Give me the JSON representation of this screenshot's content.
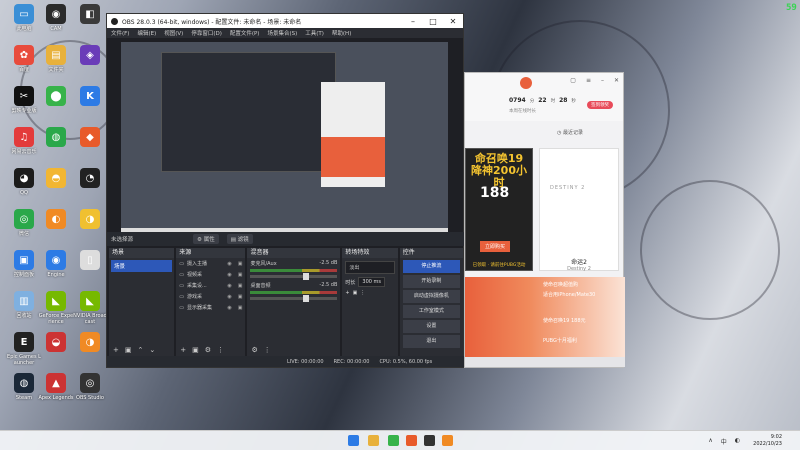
{
  "desktop": {
    "icons": [
      {
        "label": "此电脑",
        "color": "#3b8fd6",
        "glyph": "▭"
      },
      {
        "label": "CAM",
        "color": "#2b2b2b",
        "glyph": "◉"
      },
      {
        "label": "",
        "color": "#3a3a3a",
        "glyph": "◧"
      },
      {
        "label": "百度",
        "color": "#e84b3c",
        "glyph": "✿"
      },
      {
        "label": "文件夹",
        "color": "#e8b13c",
        "glyph": "▤"
      },
      {
        "label": "",
        "color": "#6a3cb8",
        "glyph": "◈"
      },
      {
        "label": "剪映专业版",
        "color": "#111",
        "glyph": "✂"
      },
      {
        "label": "",
        "color": "#37b34a",
        "glyph": "⬤"
      },
      {
        "label": "",
        "color": "#2d7be5",
        "glyph": "K"
      },
      {
        "label": "网易云音乐",
        "color": "#e33b3b",
        "glyph": "♫"
      },
      {
        "label": "",
        "color": "#2aa84a",
        "glyph": "◍"
      },
      {
        "label": "",
        "color": "#e85a2a",
        "glyph": "◆"
      },
      {
        "label": "QQ",
        "color": "#1c1c1c",
        "glyph": "◕"
      },
      {
        "label": "",
        "color": "#f2b632",
        "glyph": "◓"
      },
      {
        "label": "",
        "color": "#222",
        "glyph": "◔"
      },
      {
        "label": "微信",
        "color": "#2aa84a",
        "glyph": "◎"
      },
      {
        "label": "",
        "color": "#f08a24",
        "glyph": "◐"
      },
      {
        "label": "",
        "color": "#f0c030",
        "glyph": "◑"
      },
      {
        "label": "控制面板",
        "color": "#2d7be5",
        "glyph": "▣"
      },
      {
        "label": "Engine",
        "color": "#2d7be5",
        "glyph": "◉"
      },
      {
        "label": "",
        "color": "#ddd",
        "glyph": "▯"
      },
      {
        "label": "回收站",
        "color": "#7fb0e0",
        "glyph": "▥"
      },
      {
        "label": "GeForce Experience",
        "color": "#76b900",
        "glyph": "◣"
      },
      {
        "label": "NVIDIA Broadcast",
        "color": "#76b900",
        "glyph": "◣"
      },
      {
        "label": "Epic Games Launcher",
        "color": "#222",
        "glyph": "E"
      },
      {
        "label": "",
        "color": "#c33",
        "glyph": "◒"
      },
      {
        "label": "",
        "color": "#f08a24",
        "glyph": "◑"
      },
      {
        "label": "Steam",
        "color": "#1b2838",
        "glyph": "◍"
      },
      {
        "label": "Apex Legends",
        "color": "#c33",
        "glyph": "▲"
      },
      {
        "label": "OBS Studio",
        "color": "#333",
        "glyph": "◎"
      }
    ],
    "fps": "59"
  },
  "obs": {
    "title": "OBS 28.0.3 (64-bit, windows) - 配置文件: 未命名 - 场景: 未命名",
    "menu": [
      "文件(F)",
      "编辑(E)",
      "视图(V)",
      "停靠窗口(D)",
      "配置文件(P)",
      "场景集合(S)",
      "工具(T)",
      "帮助(H)"
    ],
    "source_bar": {
      "label": "未选择源",
      "properties": "属性",
      "filters": "滤镜"
    },
    "docks": {
      "scenes": {
        "title": "场景",
        "items": [
          "场景"
        ]
      },
      "sources": {
        "title": "来源",
        "items": [
          {
            "name": "摄入主播"
          },
          {
            "name": "视频采"
          },
          {
            "name": "采集设..."
          },
          {
            "name": "游戏采"
          },
          {
            "name": "显示器采集"
          }
        ]
      },
      "mixer": {
        "title": "混音器",
        "tracks": [
          {
            "name": "麦克风/Aux",
            "db": "-2.5 dB",
            "level": 0.6
          },
          {
            "name": "桌面音频",
            "db": "-2.5 dB",
            "level": 0.6
          }
        ]
      },
      "transitions": {
        "title": "转场特效",
        "type": "淡出",
        "duration_label": "时长",
        "duration": "300 ms"
      },
      "controls": {
        "title": "控件",
        "buttons": [
          "停止推流",
          "开始录制",
          "启动虚拟摄像机",
          "工作室模式",
          "设置",
          "退出"
        ]
      }
    },
    "status": {
      "live": "LIVE: 00:00:00",
      "rec": "REC: 00:00:00",
      "cpu": "CPU: 0.5%, 60.00 fps"
    }
  },
  "gamecenter": {
    "stats": [
      {
        "value": "0794",
        "unit": "分"
      },
      {
        "value": "22",
        "unit": "时"
      },
      {
        "value": "28",
        "unit": "秒"
      }
    ],
    "sub": "本周在线时长",
    "pill": "签到领奖",
    "recent": "最近记录",
    "card1": {
      "line1": "命召唤19",
      "line2": "降神200小时",
      "price": "188",
      "note": "已领取 · 请前往PUBG活动",
      "button": "立即购买"
    },
    "card2": {
      "logo": "DESTINY 2",
      "name": "命运2",
      "en": "Destiny 2"
    },
    "banner": [
      "使命召唤超值购",
      "适合用iPhone/Mate30",
      "使命召唤19 188元",
      "PUBG十月福利"
    ],
    "footer": [
      "",
      "",
      "",
      "",
      ""
    ]
  },
  "taskbar": {
    "tray": [
      "∧",
      "中",
      "◐"
    ],
    "time": "9:02",
    "date": "2022/10/23"
  }
}
